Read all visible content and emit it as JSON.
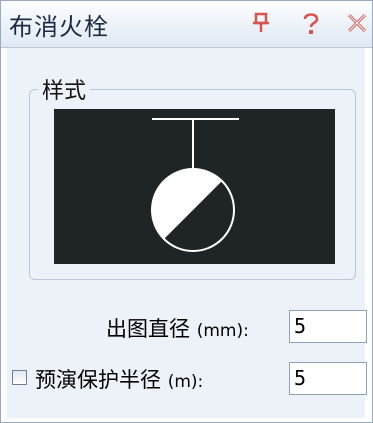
{
  "window": {
    "title": "布消火栓",
    "pin_icon": "pin-icon",
    "help_icon": "help-icon",
    "close_icon": "close-icon"
  },
  "style_group": {
    "label": "样式",
    "preview_icon": "fire-hydrant-symbol"
  },
  "fields": {
    "diameter": {
      "label": "出图直径",
      "unit": "(mm):",
      "value": "5"
    },
    "protect_radius": {
      "label": "预演保护半径",
      "unit": "(m):",
      "value": "5",
      "checked": false
    }
  },
  "colors": {
    "preview_bg": "#1f2526",
    "symbol": "#ffffff",
    "accent": "#d9534f"
  }
}
